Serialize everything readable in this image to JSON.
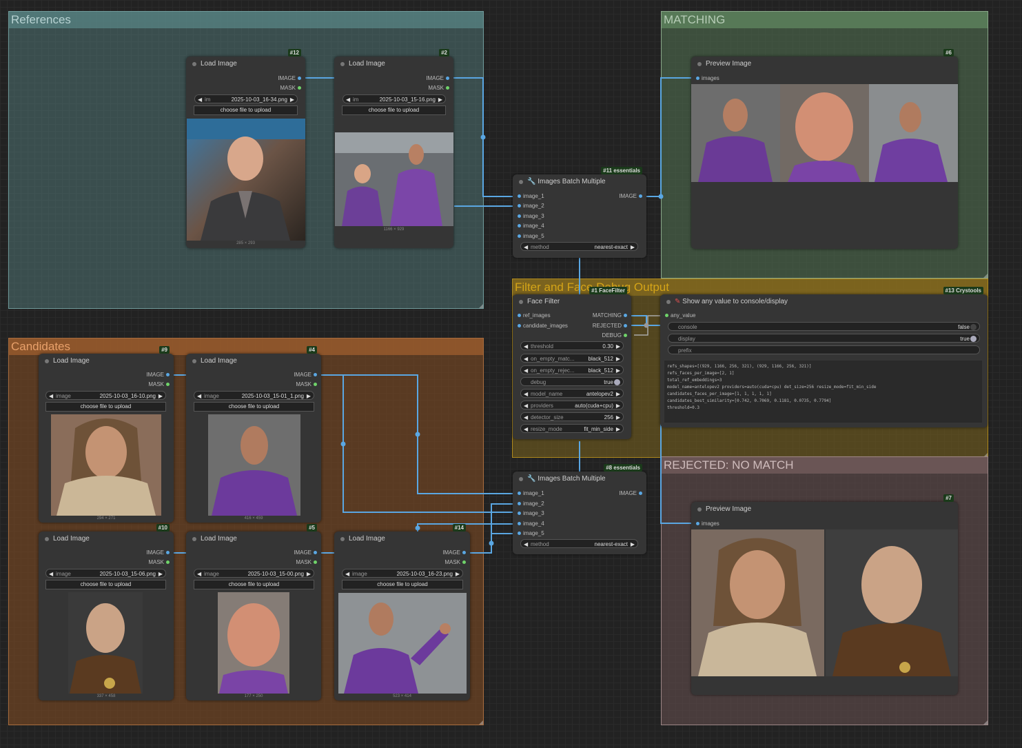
{
  "groups": {
    "references": "References",
    "candidates": "Candidates",
    "matching": "MATCHING",
    "filter": "Filter and Face Debug Output",
    "rejected": "REJECTED: NO MATCH"
  },
  "load_image": {
    "title": "Load Image",
    "out_image": "IMAGE",
    "out_mask": "MASK",
    "upload": "choose file to upload"
  },
  "nodes": {
    "n12": {
      "badge": "#12",
      "label": "im",
      "file": "2025-10-03_16-34.png",
      "dims": "285 × 293"
    },
    "n2": {
      "badge": "#2",
      "label": "im",
      "file": "2025-10-03_15-16.png",
      "dims": "1166 × 929"
    },
    "n9": {
      "badge": "#9",
      "label": "image",
      "file": "2025-10-03_16-10.png",
      "dims": "294 × 271"
    },
    "n4": {
      "badge": "#4",
      "label": "image",
      "file": "2025-10-03_15-01_1.png",
      "dims": "416 × 459"
    },
    "n10": {
      "badge": "#10",
      "label": "image",
      "file": "2025-10-03_15-06.png",
      "dims": "337 × 458"
    },
    "n5": {
      "badge": "#5",
      "label": "image",
      "file": "2025-10-03_15-00.png",
      "dims": "177 × 250"
    },
    "n14": {
      "badge": "#14",
      "label": "image",
      "file": "2025-10-03_16-23.png",
      "dims": "523 × 414"
    }
  },
  "batch": {
    "title": "Images Batch Multiple",
    "badge_top": "#11 essentials",
    "badge_bottom": "#8 essentials",
    "inputs": [
      "image_1",
      "image_2",
      "image_3",
      "image_4",
      "image_5"
    ],
    "output": "IMAGE",
    "method_label": "method",
    "method_value": "nearest-exact"
  },
  "face_filter": {
    "title": "Face Filter",
    "badge": "#1 FaceFilter",
    "inputs": [
      "ref_images",
      "candidate_images"
    ],
    "outputs": [
      "MATCHING",
      "REJECTED",
      "DEBUG"
    ],
    "widgets": [
      {
        "label": "threshold",
        "value": "0.30"
      },
      {
        "label": "on_empty_matc...",
        "value": "black_512"
      },
      {
        "label": "on_empty_rejec...",
        "value": "black_512"
      },
      {
        "label": "debug",
        "value": "true"
      },
      {
        "label": "model_name",
        "value": "antelopev2"
      },
      {
        "label": "providers",
        "value": "auto(cuda+cpu)"
      },
      {
        "label": "detector_size",
        "value": "256"
      },
      {
        "label": "resize_mode",
        "value": "fit_min_side"
      }
    ]
  },
  "show_any": {
    "title": "Show any value to console/display",
    "badge": "#13 Crystools",
    "input": "any_value",
    "console_label": "console",
    "console_value": "false",
    "display_label": "display",
    "display_value": "true",
    "prefix_label": "prefix",
    "output_text": "refs_shapes=[(929, 1166, 256, 321), (929, 1166, 256, 321)]\nrefs_faces_per_image=[2, 1]\ntotal_ref_embeddings=3\nmodel_name=antelopev2 providers=auto(cuda+cpu) det_size=256 resize_mode=fit_min_side\ncandidates_faces_per_image=[1, 1, 1, 1, 1]\ncandidates_best_similarity=[0.742, 0.7069, 0.1181, 0.0735, 0.7794]\nthreshold=0.3"
  },
  "preview": {
    "title": "Preview Image",
    "input": "images",
    "badge_match": "#6",
    "badge_rej": "#7"
  },
  "colors": {
    "wire": "#5aa7e3",
    "image_port": "#5aa7e3",
    "mask_port": "#6fd36a"
  }
}
